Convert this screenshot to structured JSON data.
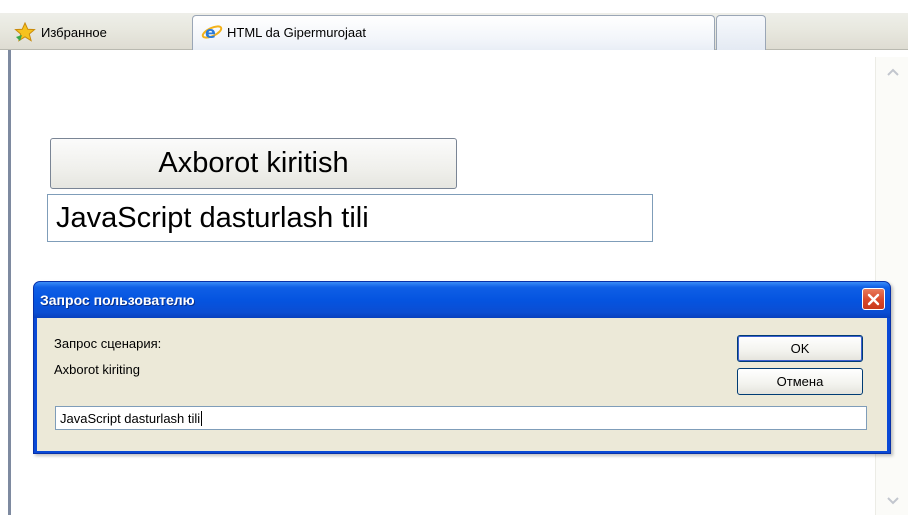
{
  "browser": {
    "favorites_label": "Избранное",
    "active_tab_title": "HTML da Gipermurojaat"
  },
  "page": {
    "button_label": "Axborot kiritish",
    "output_text": "JavaScript dasturlash tili"
  },
  "dialog": {
    "title": "Запрос пользователю",
    "prompt_label": "Запрос сценария:",
    "message": "Axborot kiriting",
    "ok_label": "OK",
    "cancel_label": "Отмена",
    "input_value": "JavaScript dasturlash tili"
  },
  "colors": {
    "titlebar_blue": "#0554e0",
    "dialog_body": "#ece9d8",
    "close_red": "#d9482a"
  }
}
